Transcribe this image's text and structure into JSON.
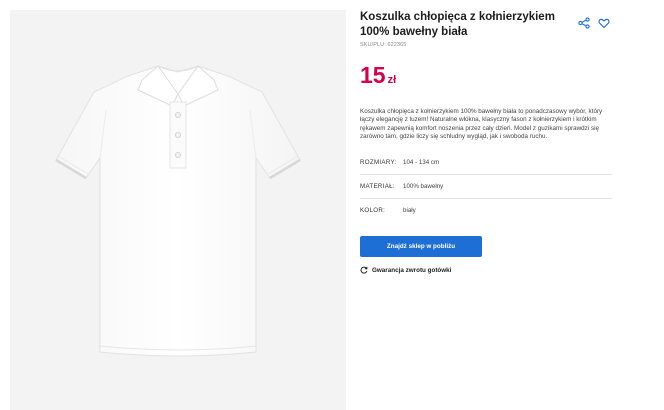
{
  "product": {
    "title": "Koszulka chłopięca z kołnierzykiem 100% bawełny biała",
    "sku": "SKU/PLU: 622365",
    "price": {
      "amount": "15",
      "currency": "zł",
      "color": "#d3004f"
    },
    "description": "Koszulka chłopięca z kołnierzykiem 100% bawełny biała to ponadczasowy wybór, który łączy elegancję z luzem! Naturalne włókna, klasyczny fason z kołnierzykiem i krótkim rękawem zapewnią komfort noszenia przez cały dzień. Model z guzikami sprawdzi się zarówno tam, gdzie liczy się schludny wygląd, jak i swoboda ruchu.",
    "attributes": [
      {
        "label": "ROZMIARY:",
        "value": "104 - 134 cm"
      },
      {
        "label": "MATERIAŁ:",
        "value": "100% bawełny"
      },
      {
        "label": "KOLOR:",
        "value": "biały"
      }
    ],
    "image": {
      "alt": "white polo shirt"
    }
  },
  "actions": {
    "share_icon": "share-icon",
    "wishlist_icon": "heart-icon",
    "find_store_label": "Znajdź sklep w pobliżu",
    "guarantee_label": "Gwarancja zwrotu gotówki",
    "guarantee_icon": "refresh-icon"
  },
  "colors": {
    "accent": "#d3004f",
    "button": "#1d6fd6",
    "gallery_bg": "#f3f3f3"
  }
}
